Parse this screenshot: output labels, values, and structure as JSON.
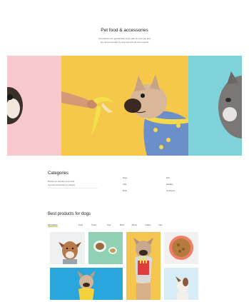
{
  "hero": {
    "title": "Pet food & accessories",
    "subtitle_line1": "All products are guaranteed to be safe for your pet and",
    "subtitle_line2": "are recommended by vets and animal care experts"
  },
  "colors": {
    "pink": "#f7c9cd",
    "yellow": "#f6c84a",
    "teal": "#7dd3d9",
    "accent": "#e0b63c"
  },
  "categories": {
    "title": "Categories",
    "intro_line1": "Browse our selection of pet food,",
    "intro_line2": "toys and accessories by category",
    "col1": [
      "Dogs",
      "Cats",
      "Birds"
    ],
    "col2": [
      "Fish",
      "Reptiles",
      "Small pets"
    ]
  },
  "products": {
    "title": "Best products for dogs",
    "tabs": [
      "All products",
      "Food",
      "Treats",
      "Toys",
      "Beds",
      "Bowls",
      "Collars",
      "Care"
    ]
  }
}
